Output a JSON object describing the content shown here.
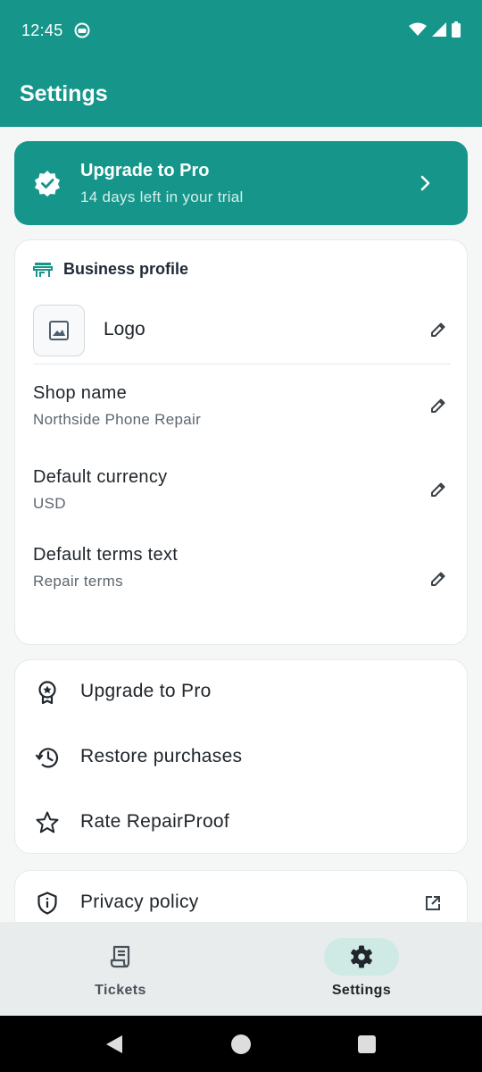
{
  "status_bar": {
    "time": "12:45"
  },
  "app_bar": {
    "title": "Settings"
  },
  "upgrade_banner": {
    "title": "Upgrade to Pro",
    "subtitle": "14 days left in your trial"
  },
  "business_profile": {
    "title": "Business profile",
    "logo_label": "Logo",
    "fields": [
      {
        "title": "Shop name",
        "value": "Northside Phone Repair"
      },
      {
        "title": "Default currency",
        "value": "USD"
      },
      {
        "title": "Default terms text",
        "value": "Repair terms"
      }
    ]
  },
  "actions": [
    {
      "label": "Upgrade to Pro",
      "icon": "award-icon"
    },
    {
      "label": "Restore purchases",
      "icon": "history-icon"
    },
    {
      "label": "Rate RepairProof",
      "icon": "star-icon"
    }
  ],
  "links": [
    {
      "label": "Privacy policy",
      "icon": "shield-info-icon"
    }
  ],
  "bottom_nav": [
    {
      "label": "Tickets",
      "icon": "receipt-icon",
      "active": false
    },
    {
      "label": "Settings",
      "icon": "gear-icon",
      "active": true
    }
  ],
  "colors": {
    "primary": "#16968a",
    "pill": "#cfe9e4",
    "background": "#f5f6f6"
  }
}
